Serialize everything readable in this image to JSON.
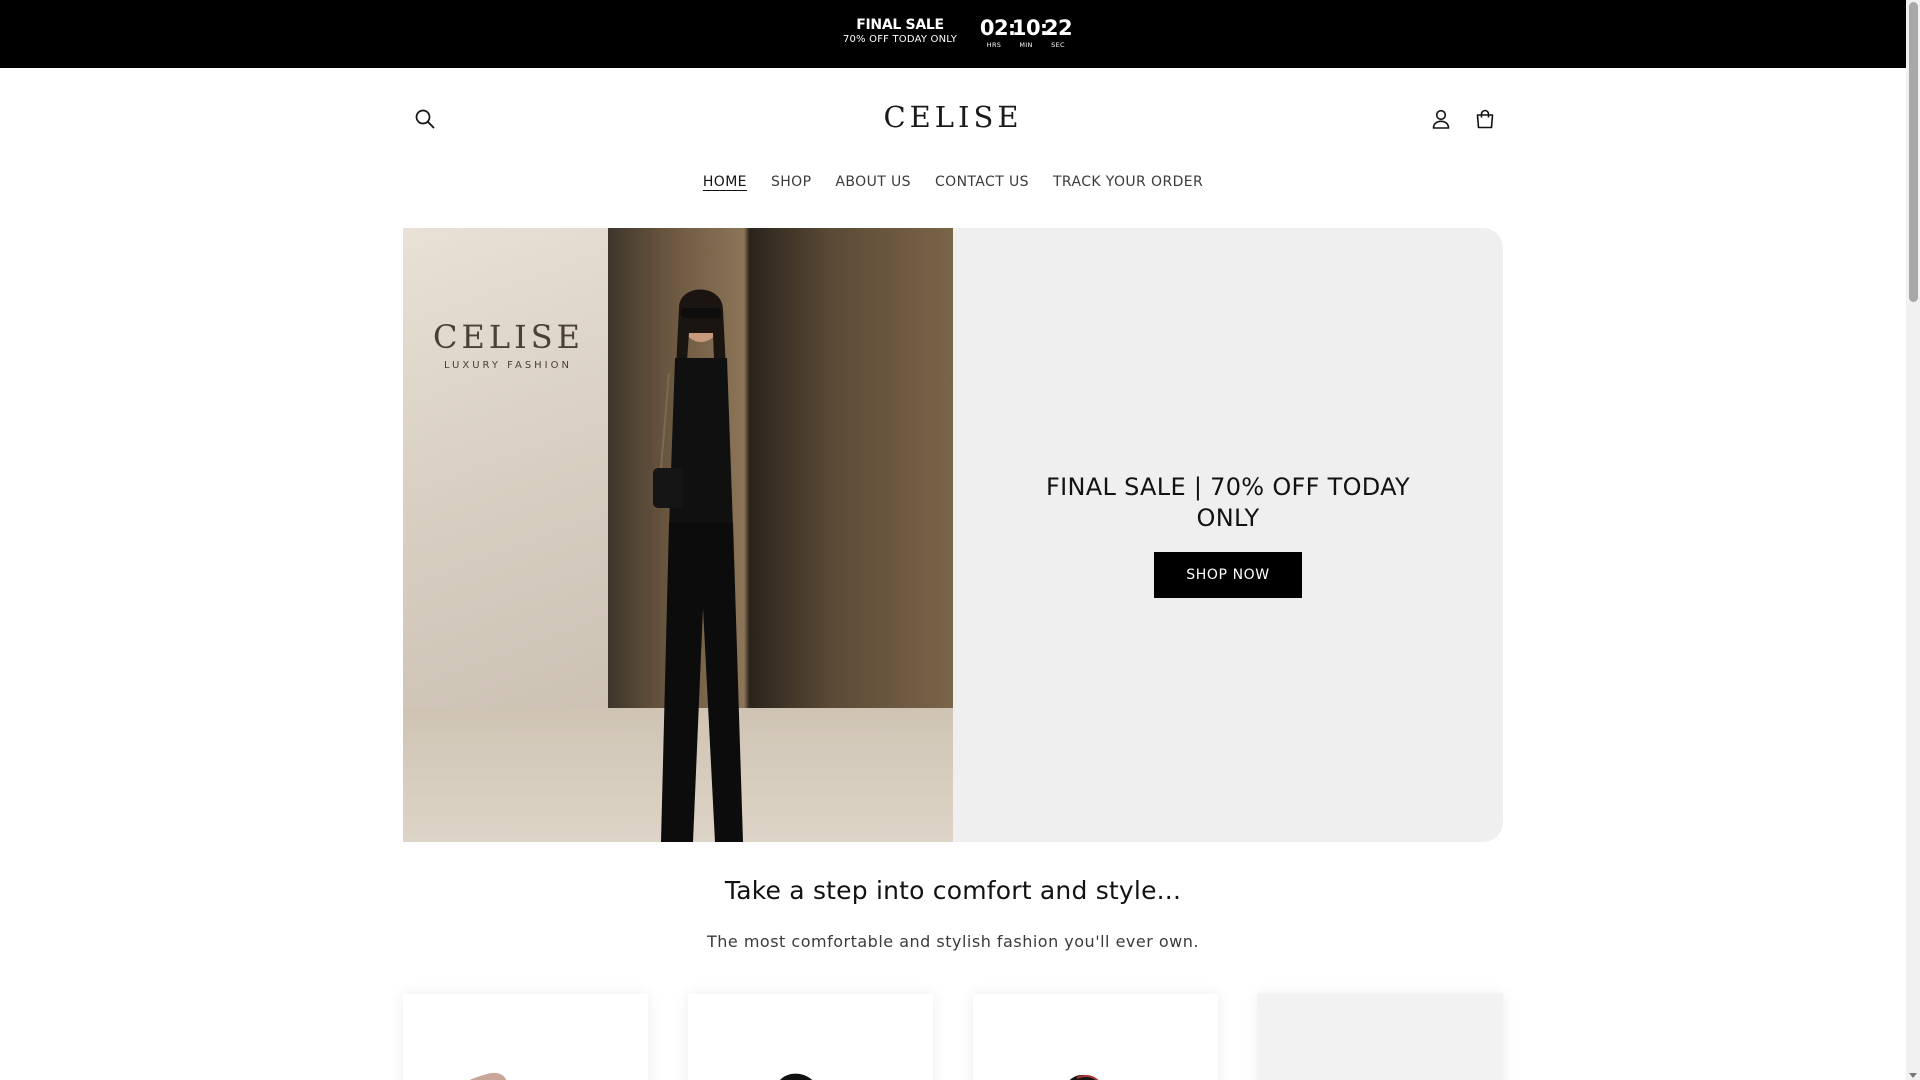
{
  "announcement": {
    "title": "FINAL SALE",
    "subtitle": "70% OFF TODAY ONLY",
    "timer": {
      "hours": "02",
      "minutes": "10",
      "seconds": "22",
      "hours_label": "HRS",
      "minutes_label": "MIN",
      "seconds_label": "SEC"
    }
  },
  "header": {
    "logo": "CELISE",
    "icons": {
      "search": "search-icon",
      "account": "account-icon",
      "cart": "cart-icon"
    }
  },
  "nav": {
    "items": [
      {
        "label": "HOME",
        "active": true
      },
      {
        "label": "SHOP",
        "active": false
      },
      {
        "label": "ABOUT US",
        "active": false
      },
      {
        "label": "CONTACT US",
        "active": false
      },
      {
        "label": "TRACK YOUR ORDER",
        "active": false
      }
    ]
  },
  "hero": {
    "image_brand": "CELISE",
    "image_brand_tagline": "LUXURY FASHION",
    "title": "FINAL SALE | 70% OFF TODAY ONLY",
    "button": "SHOP NOW"
  },
  "section": {
    "title": "Take a step into comfort and style...",
    "subtitle": "The most comfortable and stylish fashion you'll ever own."
  },
  "colors": {
    "announcement_bg": "#000000",
    "hero_panel_bg": "#efefef",
    "button_bg": "#000000",
    "text": "#121212"
  }
}
